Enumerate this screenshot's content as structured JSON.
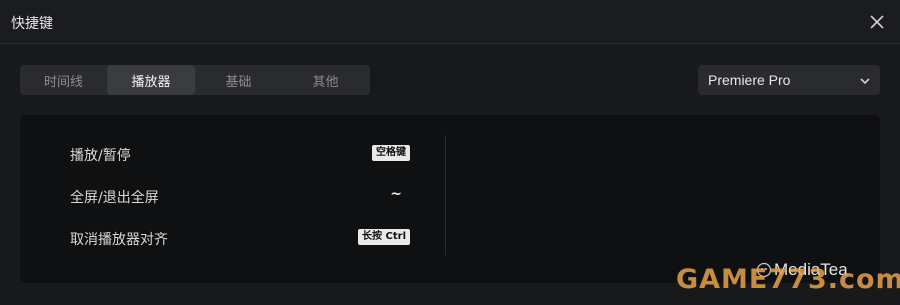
{
  "window": {
    "title": "快捷键"
  },
  "tabs": [
    {
      "label": "时间线",
      "active": false
    },
    {
      "label": "播放器",
      "active": true
    },
    {
      "label": "基础",
      "active": false
    },
    {
      "label": "其他",
      "active": false
    }
  ],
  "preset": {
    "selected": "Premiere Pro"
  },
  "shortcuts": [
    {
      "action": "播放/暂停",
      "key": "空格键"
    },
    {
      "action": "全屏/退出全屏",
      "key": "~"
    },
    {
      "action": "取消播放器对齐",
      "key": "长按 Ctrl"
    }
  ],
  "watermark": {
    "brand": "GAME773.com",
    "text": "MediaTea"
  },
  "icons": {
    "close": "close-icon",
    "dropdown": "chevron-down-icon"
  },
  "colors": {
    "background": "#18191b",
    "panel": "#0f1012",
    "tab_active": "#3b3c40",
    "key_badge": "#e9e9e9"
  }
}
